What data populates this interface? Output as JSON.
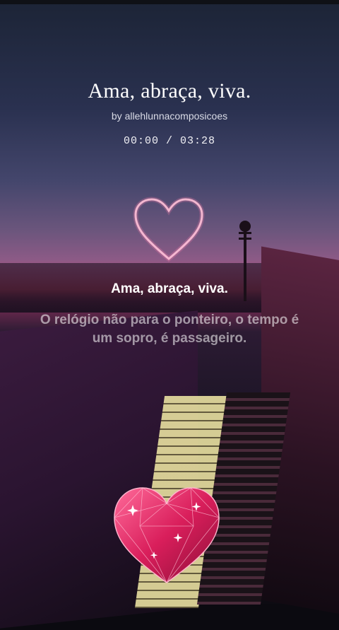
{
  "song": {
    "title": "Ama, abraça, viva.",
    "artist_line": "by allehlunnacomposicoes"
  },
  "player": {
    "time_display": "00:00 / 03:28"
  },
  "lyrics": {
    "current": "Ama, abraça, viva.",
    "next": "O relógio não para o ponteiro, o tempo é um sopro, é passageiro."
  },
  "icons": {
    "neon_heart": "heart-outline-icon",
    "gem_heart": "diamond-heart-icon"
  },
  "colors": {
    "accent_pink": "#e0306a",
    "sunset": "#d8496f",
    "text": "#ffffff"
  }
}
